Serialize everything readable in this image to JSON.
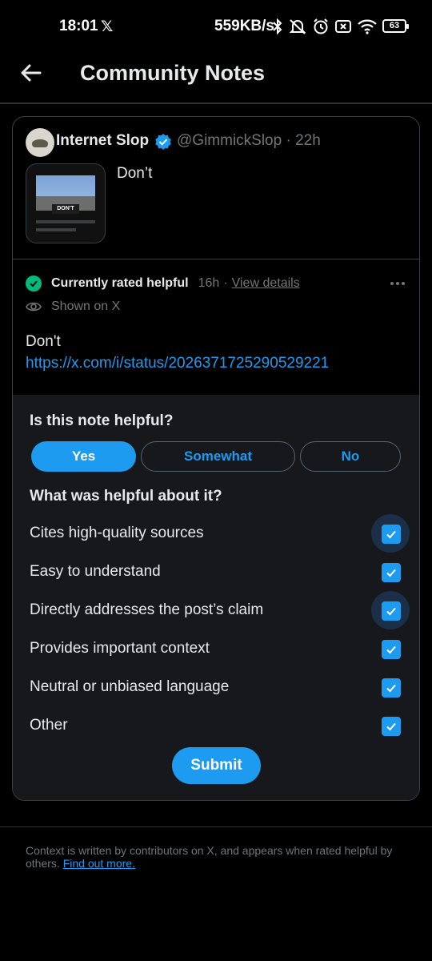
{
  "status_bar": {
    "time": "18:01",
    "x_logo": "𝕏",
    "net_speed": "559KB/s",
    "battery": "63",
    "icons": [
      "bluetooth-icon",
      "mute-icon",
      "alarm-icon",
      "no-sim-icon",
      "wifi-icon",
      "battery-icon"
    ]
  },
  "header": {
    "title": "Community Notes",
    "back_icon": "arrow-left-icon"
  },
  "post": {
    "author_name": "Internet Slop",
    "handle_time": "@GimmickSlop · 22h",
    "text": "Don’t",
    "thumbnail_sign_text": "DON'T"
  },
  "note": {
    "status_label": "Currently rated helpful",
    "status_time": "16h",
    "separator": "·",
    "details_link": "View details",
    "shown_label": "Shown on X",
    "text": "Don't",
    "link": "https://x.com/i/status/2026371725290529221"
  },
  "rating": {
    "question": "Is this note helpful?",
    "options": {
      "yes": "Yes",
      "somewhat": "Somewhat",
      "no": "No"
    },
    "selected": "Yes",
    "followup_question": "What was helpful about it?",
    "reasons": [
      {
        "label": "Cites high-quality sources",
        "checked": true
      },
      {
        "label": "Easy to understand",
        "checked": true
      },
      {
        "label": "Directly addresses the post’s claim",
        "checked": true
      },
      {
        "label": "Provides important context",
        "checked": true
      },
      {
        "label": "Neutral or unbiased language",
        "checked": true
      },
      {
        "label": "Other",
        "checked": true
      }
    ],
    "submit": "Submit"
  },
  "footer": {
    "text": "Context is written by contributors on X, and appears when rated helpful by others.",
    "link": "Find out more."
  },
  "colors": {
    "accent": "#1d9bf0",
    "success": "#00ba7c",
    "background": "#000000",
    "panel": "#16181c"
  }
}
